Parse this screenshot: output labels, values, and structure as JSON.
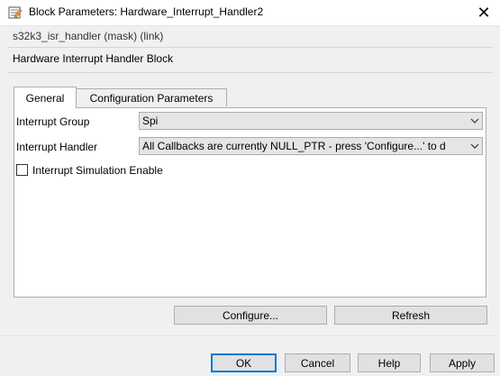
{
  "window": {
    "title": "Block Parameters: Hardware_Interrupt_Handler2",
    "close_glyph": "✕"
  },
  "header": {
    "subtitle": "s32k3_isr_handler (mask) (link)",
    "description": "Hardware Interrupt Handler Block"
  },
  "tabs": [
    {
      "label": "General",
      "active": true
    },
    {
      "label": "Configuration Parameters",
      "active": false
    }
  ],
  "general": {
    "interrupt_group": {
      "label": "Interrupt Group",
      "value": "Spi"
    },
    "interrupt_handler": {
      "label": "Interrupt Handler",
      "value": "All Callbacks are currently NULL_PTR - press 'Configure...' to d"
    },
    "simulation": {
      "label": "Interrupt Simulation Enable",
      "checked": false
    }
  },
  "actions": {
    "configure": "Configure...",
    "refresh": "Refresh"
  },
  "footer": {
    "ok": "OK",
    "cancel": "Cancel",
    "help": "Help",
    "apply": "Apply"
  },
  "colors": {
    "accent": "#0078d7",
    "panel_bg": "#ffffff",
    "dialog_bg": "#f0f0f0"
  },
  "icons": {
    "app": "block-parameters-icon",
    "dropdown": "chevron-down-icon"
  }
}
